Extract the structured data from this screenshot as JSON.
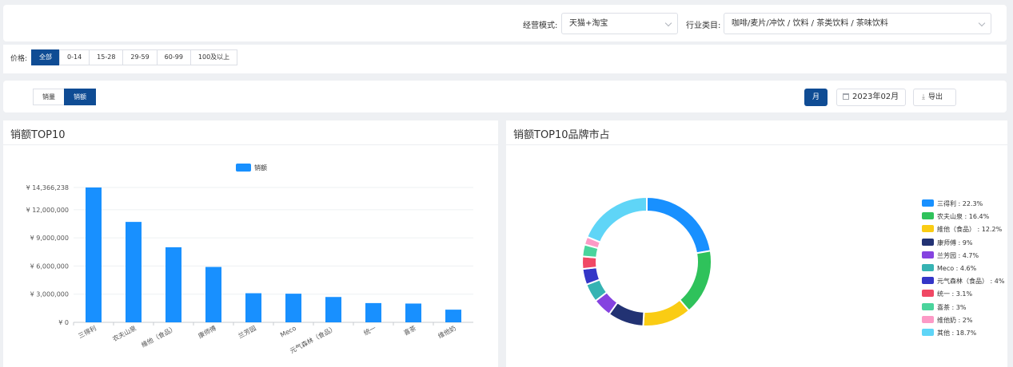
{
  "filters": {
    "mode_label": "经营模式:",
    "mode_value": "天猫+淘宝",
    "category_label": "行业类目:",
    "category_value": "咖啡/麦片/冲饮 / 饮料 / 茶类饮料 / 茶味饮料"
  },
  "price": {
    "label": "价格:",
    "options": [
      "全部",
      "0-14",
      "15-28",
      "29-59",
      "60-99",
      "100及以上"
    ],
    "selected": "全部"
  },
  "toolbar": {
    "tabs": [
      "销量",
      "销额"
    ],
    "active_tab": "销额",
    "period_button": "月",
    "date_value": "2023年02月",
    "export_label": "导出"
  },
  "icons": {
    "date": "calendar-icon",
    "export": "download-icon",
    "dropdown": "chevron-down-icon"
  },
  "bar_panel": {
    "title": "销额TOP10"
  },
  "pie_panel": {
    "title": "销额TOP10品牌市占"
  },
  "chart_data": [
    {
      "type": "bar",
      "title": "",
      "legend": [
        "销额"
      ],
      "legend_position": "top-center",
      "color": "#1890ff",
      "categories": [
        "三得利",
        "农夫山泉",
        "維他（食品）",
        "康师傅",
        "兰芳园",
        "Meco",
        "元气森林（食品）",
        "统一",
        "喜茶",
        "维他奶"
      ],
      "values": [
        14366238,
        10700000,
        8000000,
        5900000,
        3100000,
        3050000,
        2700000,
        2050000,
        2000000,
        1350000
      ],
      "ytick_labels": [
        "¥ 0",
        "¥ 3,000,000",
        "¥ 6,000,000",
        "¥ 9,000,000",
        "¥ 12,000,000",
        "¥ 14,366,238"
      ],
      "yticks": [
        0,
        3000000,
        6000000,
        9000000,
        12000000,
        14366238
      ],
      "ylim": [
        0,
        14366238
      ],
      "grid": true
    },
    {
      "type": "pie",
      "title": "",
      "donut": true,
      "legend_position": "right",
      "slices": [
        {
          "name": "三得利",
          "label": "三得利 : 22.3%",
          "value": 22.3,
          "color": "#1890ff"
        },
        {
          "name": "农夫山泉",
          "label": "农夫山泉 : 16.4%",
          "value": 16.4,
          "color": "#2fc25b"
        },
        {
          "name": "維他（食品）",
          "label": "維他（食品） : 12.2%",
          "value": 12.2,
          "color": "#facc14"
        },
        {
          "name": "康师傅",
          "label": "康师傅 : 9%",
          "value": 9,
          "color": "#223273"
        },
        {
          "name": "兰芳园",
          "label": "兰芳园 : 4.7%",
          "value": 4.7,
          "color": "#8543e0"
        },
        {
          "name": "Meco",
          "label": "Meco : 4.6%",
          "value": 4.6,
          "color": "#36b3b3"
        },
        {
          "name": "元气森林（食品）",
          "label": "元气森林（食品） : 4%",
          "value": 4,
          "color": "#3436c7"
        },
        {
          "name": "统一",
          "label": "统一 : 3.1%",
          "value": 3.1,
          "color": "#f04864"
        },
        {
          "name": "喜茶",
          "label": "喜茶 : 3%",
          "value": 3,
          "color": "#4ad49c"
        },
        {
          "name": "维他奶",
          "label": "维他奶 : 2%",
          "value": 2,
          "color": "#fc9ac6"
        },
        {
          "name": "其他",
          "label": "其他 : 18.7%",
          "value": 18.7,
          "color": "#5fd5f7"
        }
      ]
    }
  ]
}
